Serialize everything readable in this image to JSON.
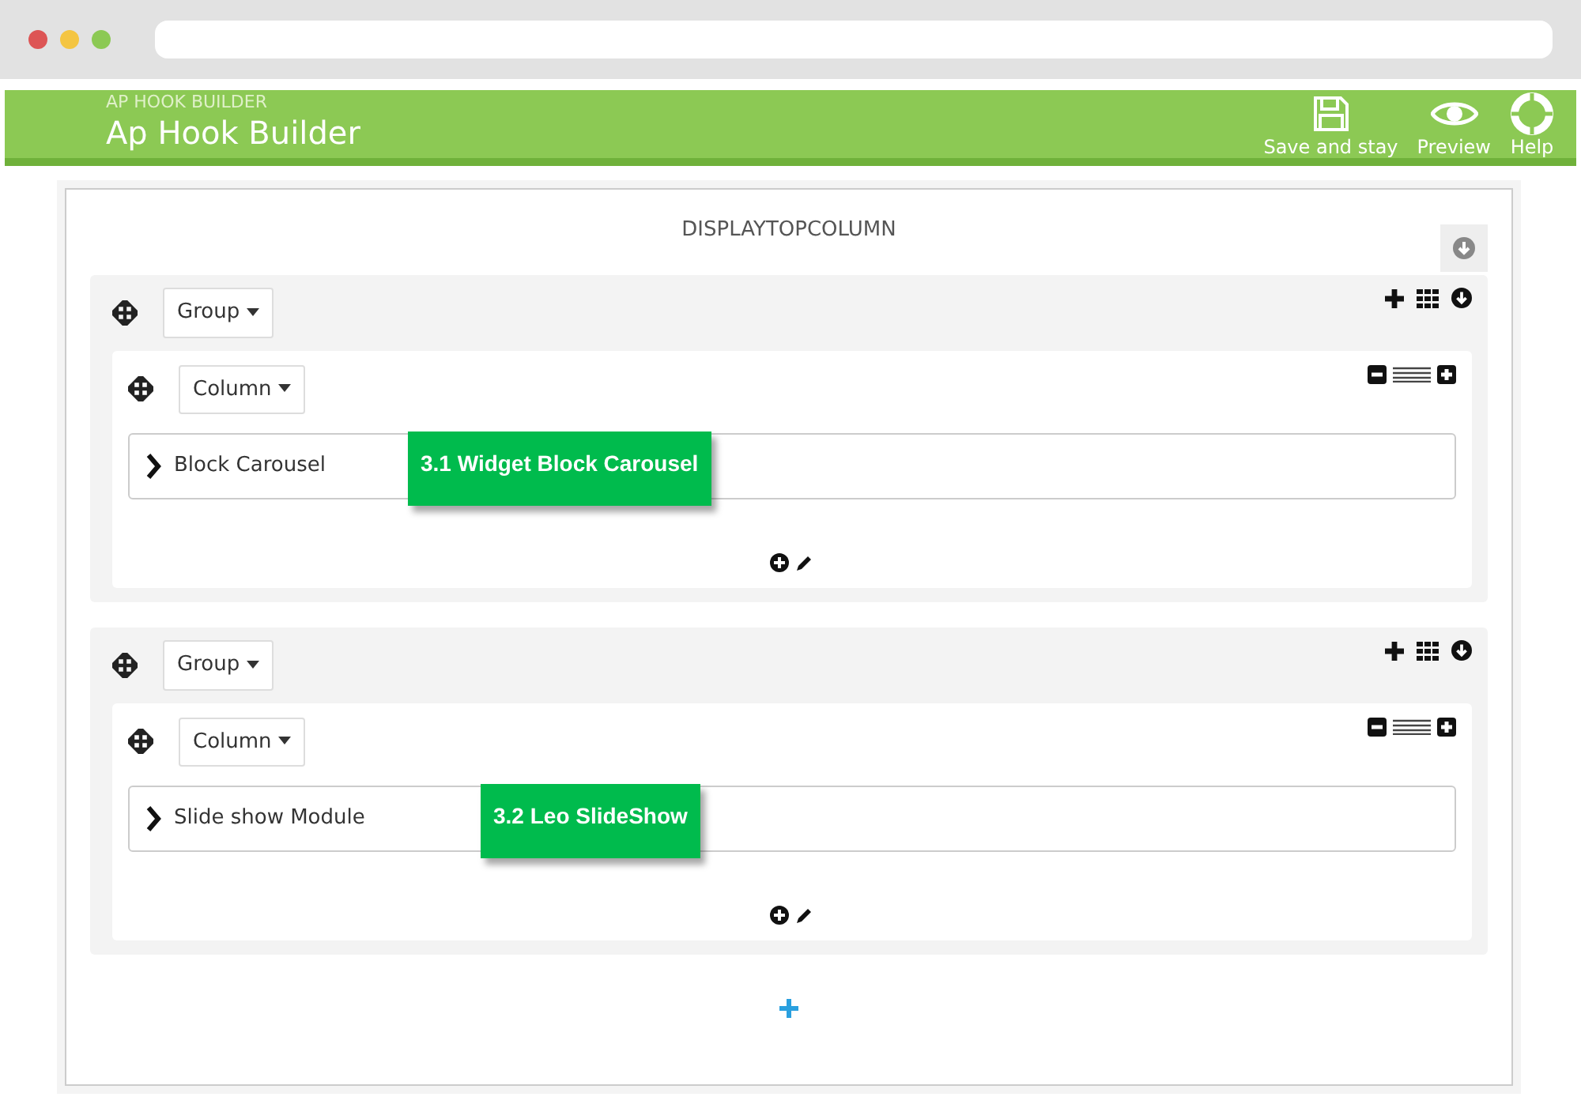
{
  "header": {
    "subtitle": "AP HOOK BUILDER",
    "title": "Ap Hook Builder",
    "actions": [
      {
        "kind": "save",
        "label": "Save and stay"
      },
      {
        "kind": "preview",
        "label": "Preview"
      },
      {
        "kind": "help",
        "label": "Help"
      }
    ]
  },
  "hook": {
    "name": "DISPLAYTOPCOLUMN",
    "groups": [
      {
        "label": "Group",
        "columns": [
          {
            "label": "Column",
            "widgets": [
              {
                "name": "Block Carousel",
                "callout": "3.1 Widget Block Carousel"
              }
            ]
          }
        ]
      },
      {
        "label": "Group",
        "columns": [
          {
            "label": "Column",
            "widgets": [
              {
                "name": "Slide show Module",
                "callout": "3.2 Leo SlideShow"
              }
            ]
          }
        ]
      }
    ]
  }
}
